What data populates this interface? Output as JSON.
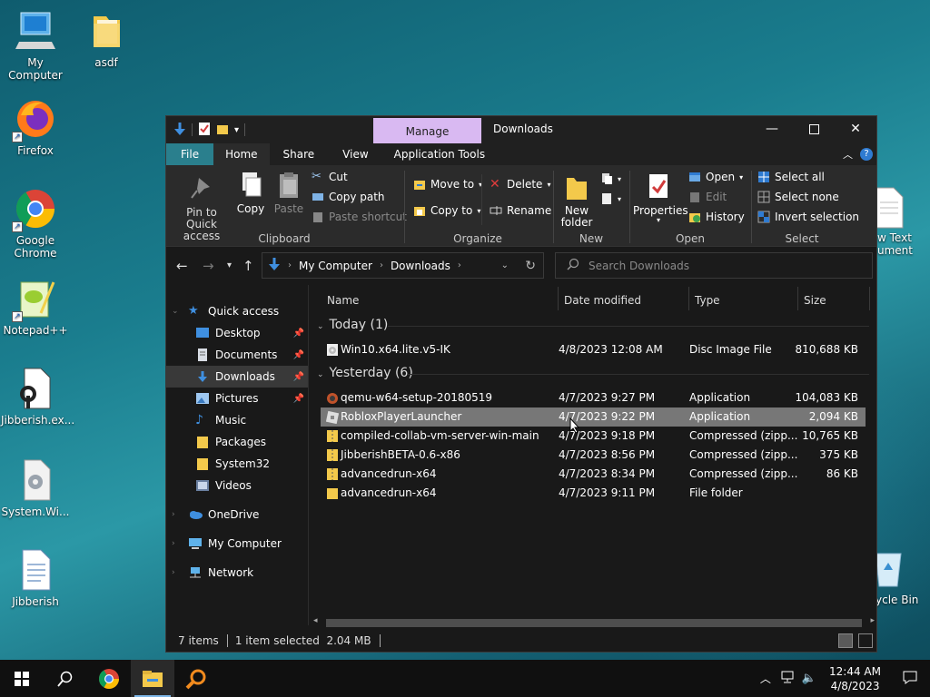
{
  "desktop": {
    "icons": [
      {
        "label": "My Computer",
        "icon": "computer-icon"
      },
      {
        "label": "asdf",
        "icon": "folder-icon"
      },
      {
        "label": "Firefox",
        "icon": "firefox-icon"
      },
      {
        "label": "Google Chrome",
        "icon": "chrome-icon"
      },
      {
        "label": "Notepad++",
        "icon": "notepadpp-icon"
      },
      {
        "label": "Jibberish.ex...",
        "icon": "exe-icon"
      },
      {
        "label": "System.Wi...",
        "icon": "gear-file-icon"
      },
      {
        "label": "Jibberish",
        "icon": "text-document-icon"
      },
      {
        "label": "w Text\nument",
        "icon": "text-document-icon"
      },
      {
        "label": "ycle Bin",
        "icon": "recycle-bin-icon"
      }
    ]
  },
  "window": {
    "title": "Downloads",
    "contextual_tab": "Manage",
    "tabs": [
      "File",
      "Home",
      "Share",
      "View",
      "Application Tools"
    ],
    "active_tab": "Home"
  },
  "ribbon": {
    "clipboard": {
      "label": "Clipboard",
      "pin": "Pin to Quick access",
      "copy": "Copy",
      "paste": "Paste",
      "cut": "Cut",
      "copy_path": "Copy path",
      "paste_shortcut": "Paste shortcut"
    },
    "organize": {
      "label": "Organize",
      "move_to": "Move to",
      "copy_to": "Copy to",
      "delete": "Delete",
      "rename": "Rename"
    },
    "new": {
      "label": "New",
      "new_folder": "New folder"
    },
    "open": {
      "label": "Open",
      "properties": "Properties",
      "open": "Open",
      "edit": "Edit",
      "history": "History"
    },
    "select": {
      "label": "Select",
      "select_all": "Select all",
      "select_none": "Select none",
      "invert": "Invert selection"
    }
  },
  "address": {
    "crumbs": [
      "My Computer",
      "Downloads"
    ],
    "search_placeholder": "Search Downloads"
  },
  "nav": {
    "quick_access": "Quick access",
    "items": [
      {
        "label": "Desktop",
        "pinned": true
      },
      {
        "label": "Documents",
        "pinned": true
      },
      {
        "label": "Downloads",
        "pinned": true,
        "selected": true
      },
      {
        "label": "Pictures",
        "pinned": true
      },
      {
        "label": "Music",
        "pinned": false
      },
      {
        "label": "Packages",
        "pinned": false
      },
      {
        "label": "System32",
        "pinned": false
      },
      {
        "label": "Videos",
        "pinned": false
      }
    ],
    "onedrive": "OneDrive",
    "my_computer": "My Computer",
    "network": "Network"
  },
  "columns": {
    "name": "Name",
    "date": "Date modified",
    "type": "Type",
    "size": "Size"
  },
  "groups": [
    {
      "title": "Today (1)",
      "files": [
        {
          "name": "Win10.x64.lite.v5-IK",
          "date": "4/8/2023 12:08 AM",
          "type": "Disc Image File",
          "size": "810,688 KB",
          "icon": "disc-image-icon"
        }
      ]
    },
    {
      "title": "Yesterday (6)",
      "files": [
        {
          "name": "qemu-w64-setup-20180519",
          "date": "4/7/2023 9:27 PM",
          "type": "Application",
          "size": "104,083 KB",
          "icon": "installer-icon"
        },
        {
          "name": "RobloxPlayerLauncher",
          "date": "4/7/2023 9:22 PM",
          "type": "Application",
          "size": "2,094 KB",
          "icon": "roblox-icon",
          "selected": true
        },
        {
          "name": "compiled-collab-vm-server-win-main",
          "date": "4/7/2023 9:18 PM",
          "type": "Compressed (zipp...",
          "size": "10,765 KB",
          "icon": "zip-folder-icon"
        },
        {
          "name": "JibberishBETA-0.6-x86",
          "date": "4/7/2023 8:56 PM",
          "type": "Compressed (zipp...",
          "size": "375 KB",
          "icon": "zip-folder-icon"
        },
        {
          "name": "advancedrun-x64",
          "date": "4/7/2023 8:34 PM",
          "type": "Compressed (zipp...",
          "size": "86 KB",
          "icon": "zip-folder-icon"
        },
        {
          "name": "advancedrun-x64",
          "date": "4/7/2023 9:11 PM",
          "type": "File folder",
          "size": "",
          "icon": "folder-icon"
        }
      ]
    }
  ],
  "status": {
    "items": "7 items",
    "selection": "1 item selected  2.04 MB"
  },
  "taskbar": {
    "time": "12:44 AM",
    "date": "4/8/2023"
  },
  "colors": {
    "manage_tab": "#d9b9f2",
    "file_tab": "#2a7f8d",
    "folder": "#f3c94b",
    "accent": "#2f7bd1"
  }
}
